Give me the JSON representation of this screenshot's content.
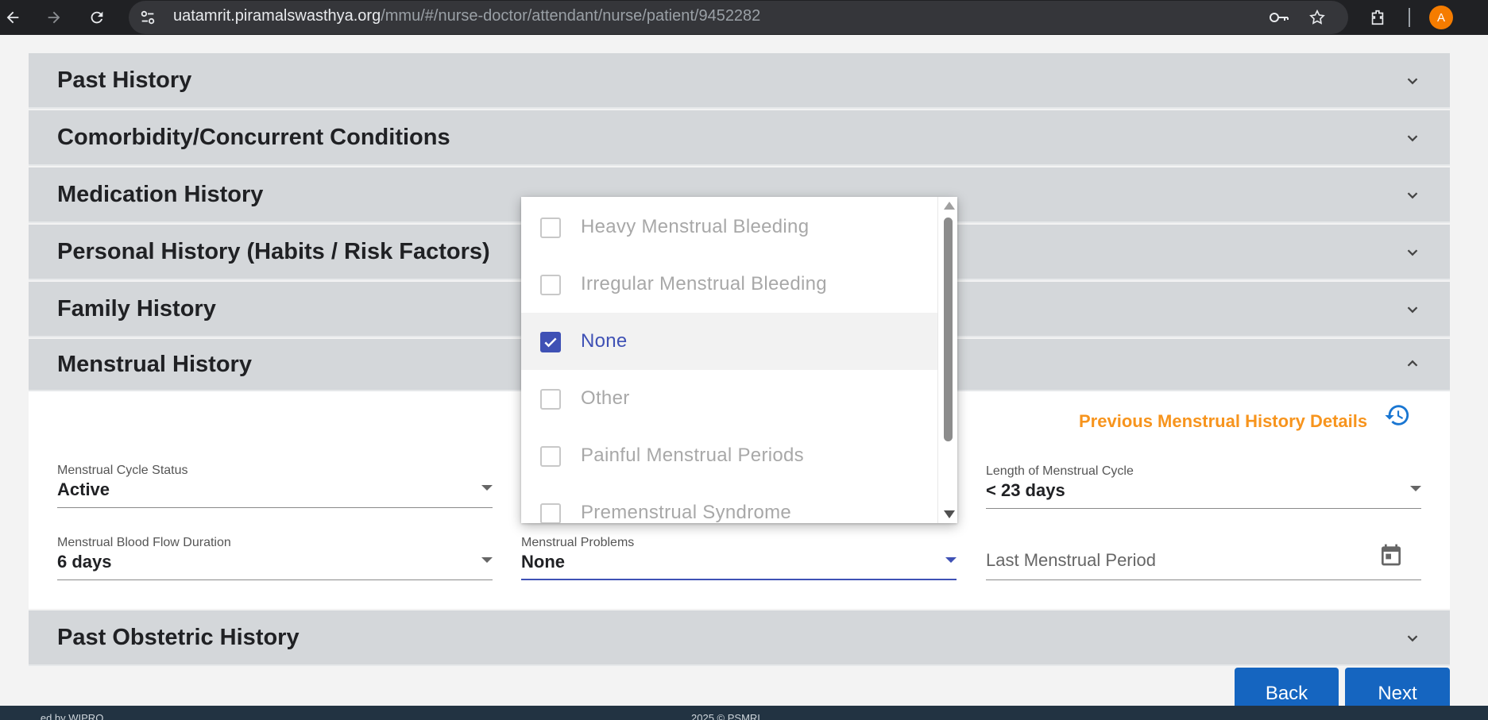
{
  "browser": {
    "url_domain": "uatamrit.piramalswasthya.org",
    "url_path": "/mmu/#/nurse-doctor/attendant/nurse/patient/9452282",
    "avatar_letter": "A"
  },
  "panels": {
    "past_history": "Past History",
    "comorbidity": "Comorbidity/Concurrent Conditions",
    "medication": "Medication History",
    "personal": "Personal History (Habits / Risk Factors)",
    "family": "Family History",
    "menstrual": "Menstrual History",
    "obstetric": "Past Obstetric History"
  },
  "menstrual": {
    "previous_link": "Previous Menstrual History Details",
    "cycle_status_label": "Menstrual Cycle Status",
    "cycle_status_value": "Active",
    "cycle_length_label": "Length of Menstrual Cycle",
    "cycle_length_value": "< 23 days",
    "flow_duration_label": "Menstrual Blood Flow Duration",
    "flow_duration_value": "6 days",
    "problems_label": "Menstrual Problems",
    "problems_value": "None",
    "lmp_placeholder": "Last Menstrual Period"
  },
  "dropdown": {
    "options": [
      {
        "label": "Heavy Menstrual Bleeding",
        "checked": false
      },
      {
        "label": "Irregular Menstrual Bleeding",
        "checked": false
      },
      {
        "label": "None",
        "checked": true
      },
      {
        "label": "Other",
        "checked": false
      },
      {
        "label": "Painful Menstrual Periods",
        "checked": false
      },
      {
        "label": "Premenstrual Syndrome",
        "checked": false
      }
    ]
  },
  "buttons": {
    "back": "Back",
    "next": "Next"
  },
  "footer": {
    "left": "...ed by WIPRO",
    "center": "2025 © PSMRI"
  },
  "colors": {
    "accent": "#3f51b5",
    "link_orange": "#f7941d",
    "button_blue": "#1565c0"
  }
}
